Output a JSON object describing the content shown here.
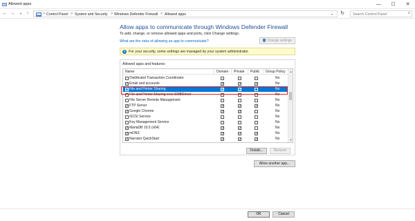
{
  "window": {
    "title": "Allowed apps",
    "controls": {
      "minimize": "—",
      "maximize": "☐",
      "close": "✕"
    }
  },
  "address": {
    "back": "←",
    "forward": "→",
    "up": "↑",
    "breadcrumbs": [
      "Control Panel",
      "System and Security",
      "Windows Defender Firewall",
      "Allowed apps"
    ],
    "separator": ">",
    "refresh": "↻",
    "search_placeholder": "Search Control Panel"
  },
  "main": {
    "heading": "Allow apps to communicate through Windows Defender Firewall",
    "subtext": "To add, change, or remove allowed apps and ports, click Change settings.",
    "risk_link": "What are the risks of allowing an app to communicate?",
    "change_settings_label": "Change settings",
    "info_message": "For your security, some settings are managed by your system administrator.",
    "info_icon": "i",
    "group_label": "Allowed apps and features:"
  },
  "table": {
    "headers": {
      "name": "Name",
      "domain": "Domain",
      "private": "Private",
      "public": "Public",
      "group_policy": "Group Policy"
    },
    "rows": [
      {
        "name": "Distributed Transaction Coordinator",
        "enabled": "",
        "domain": "",
        "private": "",
        "public": "",
        "gp": "No"
      },
      {
        "name": "Email and accounts",
        "enabled": "✓",
        "domain": "✓",
        "private": "✓",
        "public": "✓",
        "gp": "No"
      },
      {
        "name": "File and Printer Sharing",
        "enabled": "✓",
        "domain": "✓",
        "private": "✓",
        "public": "",
        "gp": "No"
      },
      {
        "name": "File and Printer Sharing over SMBDirect",
        "enabled": "",
        "domain": "",
        "private": "",
        "public": "",
        "gp": "No"
      },
      {
        "name": "File Server Remote Management",
        "enabled": "",
        "domain": "",
        "private": "",
        "public": "",
        "gp": "No"
      },
      {
        "name": "FTP Server",
        "enabled": "✓",
        "domain": "✓",
        "private": "✓",
        "public": "✓",
        "gp": "No"
      },
      {
        "name": "Google Chrome",
        "enabled": "✓",
        "domain": "✓",
        "private": "✓",
        "public": "",
        "gp": "No"
      },
      {
        "name": "iSCSI Service",
        "enabled": "",
        "domain": "",
        "private": "",
        "public": "",
        "gp": "No"
      },
      {
        "name": "Key Management Service",
        "enabled": "",
        "domain": "",
        "private": "",
        "public": "",
        "gp": "No"
      },
      {
        "name": "MariaDB 10.5 (x64)",
        "enabled": "✓",
        "domain": "✓",
        "private": "✓",
        "public": "",
        "gp": "No"
      },
      {
        "name": "mDNS",
        "enabled": "✓",
        "domain": "✓",
        "private": "✓",
        "public": "✓",
        "gp": "No"
      },
      {
        "name": "Narrator QuickStart",
        "enabled": "✓",
        "domain": "✓",
        "private": "✓",
        "public": "✓",
        "gp": "No"
      }
    ],
    "selected_row": "File and Printer Sharing"
  },
  "buttons": {
    "details": "Details...",
    "remove": "Remove",
    "allow_another": "Allow another app...",
    "ok": "OK",
    "cancel": "Cancel"
  },
  "colors": {
    "heading": "#1e4e96",
    "link": "#0066cc",
    "selection": "#0078d7",
    "highlight_border": "#e02020",
    "info_background": "#fefbce"
  }
}
